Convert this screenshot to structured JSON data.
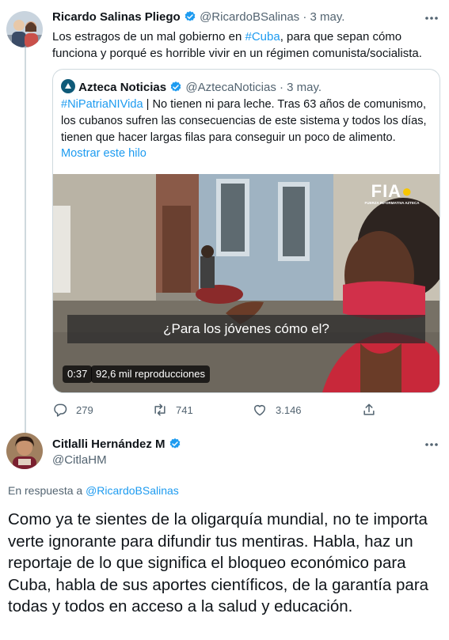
{
  "tweet1": {
    "author_name": "Ricardo Salinas Pliego",
    "handle": "@RicardoBSalinas",
    "sep": "·",
    "date": "3 may.",
    "text_before": "Los estragos de un mal gobierno en ",
    "hashtag": "#Cuba",
    "text_after": ", para que sepan cómo funciona y porqué es horrible vivir en un régimen comunista/socialista.",
    "quote": {
      "author_name": "Azteca Noticias",
      "handle": "@AztecaNoticias",
      "sep": "·",
      "date": "3 may.",
      "hashtag": "#NiPatriaNIVida",
      "text": " | No tienen ni para leche. Tras 63 años de comunismo, los cubanos sufren las consecuencias de este sistema y todos los días, tienen que hacer largas filas para conseguir un poco de alimento.",
      "show_thread": "Mostrar este hilo",
      "video": {
        "logo": "FIA",
        "logo_sub": "FUERZA INFORMATIVA AZTECA",
        "caption": "¿Para los jóvenes cómo el?",
        "duration": "0:37",
        "views": "92,6 mil reproducciones"
      }
    },
    "actions": {
      "replies": "279",
      "retweets": "741",
      "likes": "3.146"
    }
  },
  "tweet2": {
    "author_name": "Citlalli Hernández M",
    "handle": "@CitlaHM",
    "reply_prefix": "En respuesta a ",
    "reply_to": "@RicardoBSalinas",
    "text": "Como ya te sientes de la oligarquía mundial, no te importa verte ignorante para difundir tus mentiras. Habla, haz un reportaje de lo que significa el bloqueo económico para Cuba, habla de sus aportes científicos, de la garantía para todas y todos en acceso a la salud y educación."
  },
  "icons": [
    "more-icon",
    "verified-icon",
    "reply-icon",
    "retweet-icon",
    "like-icon",
    "share-icon",
    "azteca-logo-icon"
  ],
  "colors": {
    "link": "#1d9bf0",
    "text": "#0f1419",
    "muted": "#536471",
    "border": "#cfd9de"
  }
}
